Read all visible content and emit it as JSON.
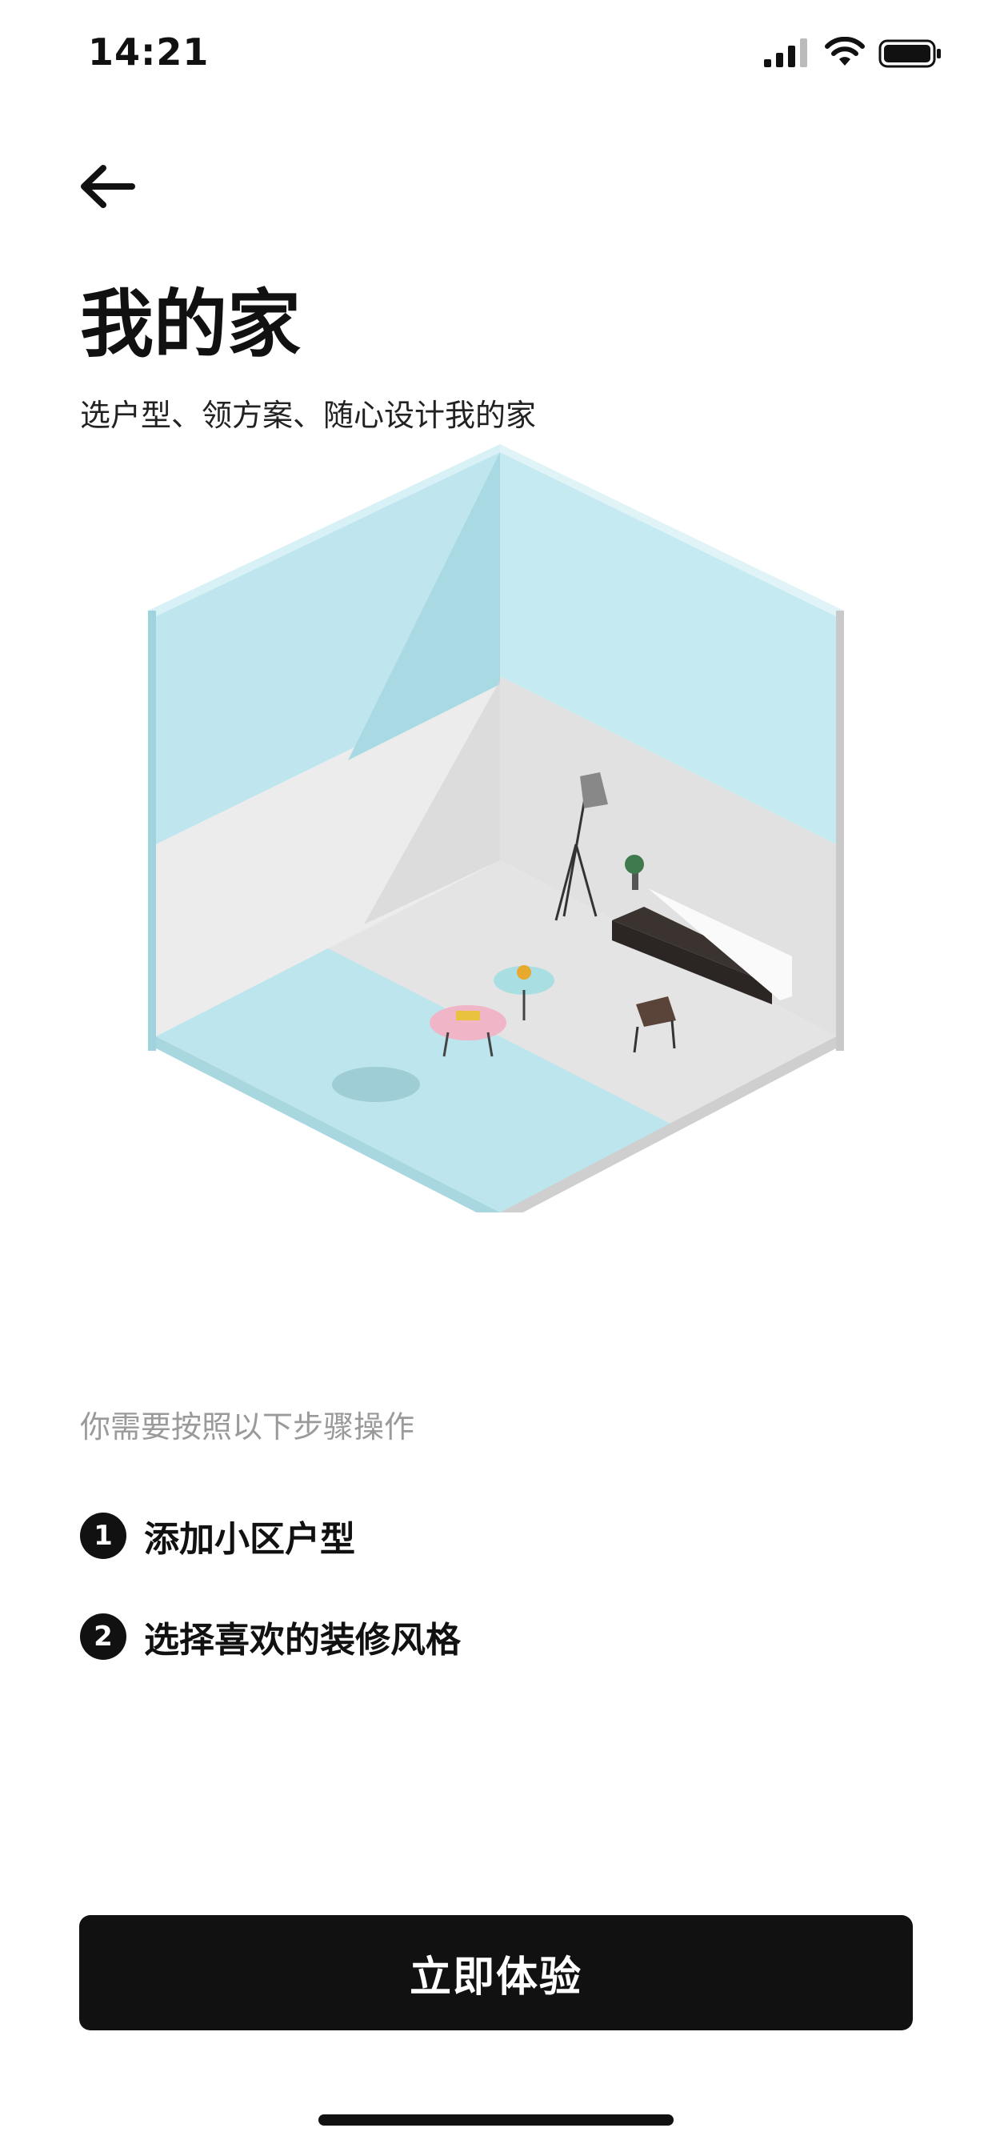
{
  "status_bar": {
    "time": "14:21"
  },
  "icons": {
    "back": "arrow-left-icon",
    "signal": "cellular-signal-icon",
    "wifi": "wifi-icon",
    "battery": "battery-icon"
  },
  "header": {
    "title": "我的家",
    "subtitle": "选户型、领方案、随心设计我的家"
  },
  "steps": {
    "hint": "你需要按照以下步骤操作",
    "items": [
      {
        "num": "1",
        "label": "添加小区户型"
      },
      {
        "num": "2",
        "label": "选择喜欢的装修风格"
      }
    ]
  },
  "cta": {
    "label": "立即体验"
  },
  "colors": {
    "accent": "#111111",
    "wall_blue": "#bfe6ee",
    "wall_grey": "#ececec"
  }
}
